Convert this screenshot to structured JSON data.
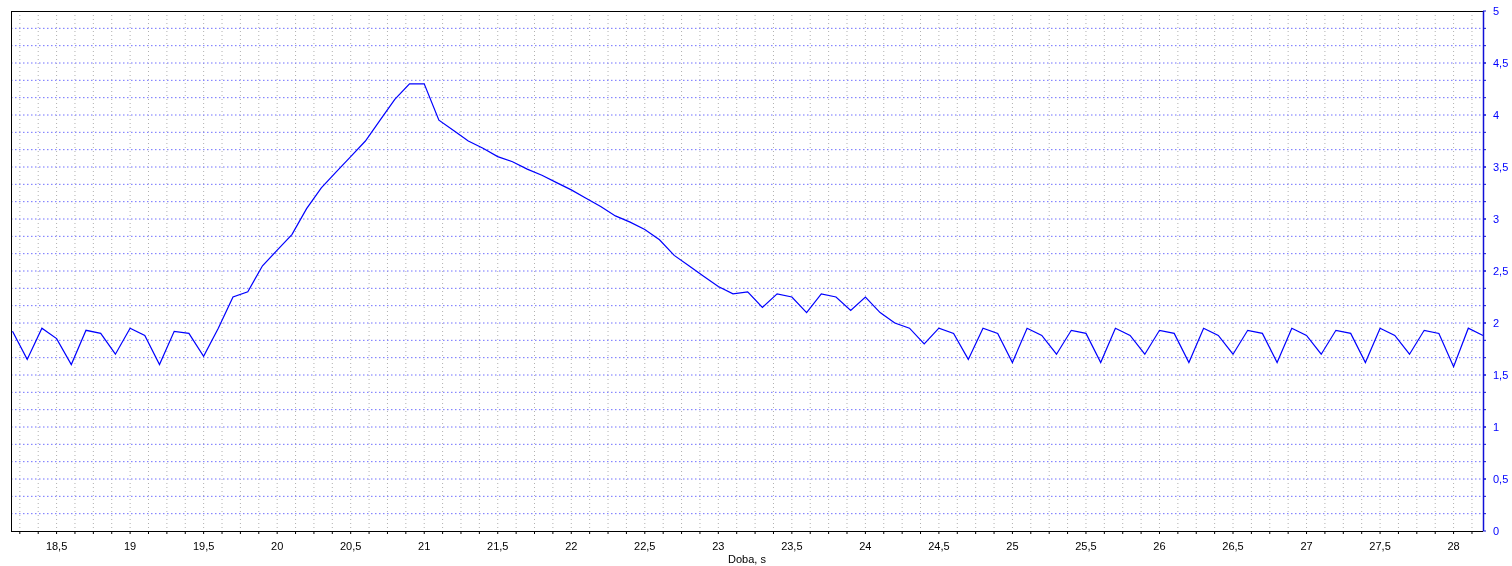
{
  "chart": {
    "chart_data": {
      "type": "line",
      "xlabel": "Doba, s",
      "grid": true,
      "xlim": [
        18.19,
        28.2
      ],
      "ylim": [
        0,
        5
      ],
      "xticks": [
        {
          "value": 18.5,
          "label": "18,5"
        },
        {
          "value": 19,
          "label": "19"
        },
        {
          "value": 19.5,
          "label": "19,5"
        },
        {
          "value": 20,
          "label": "20"
        },
        {
          "value": 20.5,
          "label": "20,5"
        },
        {
          "value": 21,
          "label": "21"
        },
        {
          "value": 21.5,
          "label": "21,5"
        },
        {
          "value": 22,
          "label": "22"
        },
        {
          "value": 22.5,
          "label": "22,5"
        },
        {
          "value": 23,
          "label": "23"
        },
        {
          "value": 23.5,
          "label": "23,5"
        },
        {
          "value": 24,
          "label": "24"
        },
        {
          "value": 24.5,
          "label": "24,5"
        },
        {
          "value": 25,
          "label": "25"
        },
        {
          "value": 25.5,
          "label": "25,5"
        },
        {
          "value": 26,
          "label": "26"
        },
        {
          "value": 26.5,
          "label": "26,5"
        },
        {
          "value": 27,
          "label": "27"
        },
        {
          "value": 27.5,
          "label": "27,5"
        },
        {
          "value": 28,
          "label": "28"
        }
      ],
      "yticks": [
        {
          "value": 0,
          "label": "0"
        },
        {
          "value": 0.5,
          "label": "0,5"
        },
        {
          "value": 1,
          "label": "1"
        },
        {
          "value": 1.5,
          "label": "1,5"
        },
        {
          "value": 2,
          "label": "2"
        },
        {
          "value": 2.5,
          "label": "2,5"
        },
        {
          "value": 3,
          "label": "3"
        },
        {
          "value": 3.5,
          "label": "3,5"
        },
        {
          "value": 4,
          "label": "4"
        },
        {
          "value": 4.5,
          "label": "4,5"
        },
        {
          "value": 5,
          "label": "5"
        }
      ],
      "x": [
        18.2,
        18.3,
        18.4,
        18.5,
        18.6,
        18.7,
        18.8,
        18.9,
        19.0,
        19.1,
        19.2,
        19.3,
        19.4,
        19.5,
        19.6,
        19.7,
        19.8,
        19.9,
        20.0,
        20.1,
        20.2,
        20.3,
        20.4,
        20.5,
        20.6,
        20.7,
        20.8,
        20.9,
        21.0,
        21.1,
        21.2,
        21.3,
        21.4,
        21.5,
        21.6,
        21.7,
        21.8,
        21.9,
        22.0,
        22.1,
        22.2,
        22.3,
        22.4,
        22.5,
        22.6,
        22.7,
        22.8,
        22.9,
        23.0,
        23.1,
        23.2,
        23.3,
        23.4,
        23.5,
        23.6,
        23.7,
        23.8,
        23.9,
        24.0,
        24.1,
        24.2,
        24.3,
        24.4,
        24.5,
        24.6,
        24.7,
        24.8,
        24.9,
        25.0,
        25.1,
        25.2,
        25.3,
        25.4,
        25.5,
        25.6,
        25.7,
        25.8,
        25.9,
        26.0,
        26.1,
        26.2,
        26.3,
        26.4,
        26.5,
        26.6,
        26.7,
        26.8,
        26.9,
        27.0,
        27.1,
        27.2,
        27.3,
        27.4,
        27.5,
        27.6,
        27.7,
        27.8,
        27.9,
        28.0,
        28.1,
        28.2
      ],
      "series": [
        {
          "color": "#0000ff",
          "values": [
            1.92,
            1.65,
            1.95,
            1.85,
            1.6,
            1.93,
            1.9,
            1.7,
            1.95,
            1.88,
            1.6,
            1.92,
            1.9,
            1.68,
            1.95,
            2.25,
            2.3,
            2.55,
            2.7,
            2.85,
            3.1,
            3.3,
            3.45,
            3.6,
            3.75,
            3.95,
            4.15,
            4.3,
            4.3,
            3.95,
            3.85,
            3.75,
            3.68,
            3.6,
            3.55,
            3.48,
            3.42,
            3.35,
            3.28,
            3.2,
            3.12,
            3.03,
            2.97,
            2.9,
            2.8,
            2.65,
            2.55,
            2.45,
            2.35,
            2.28,
            2.3,
            2.15,
            2.28,
            2.25,
            2.1,
            2.28,
            2.25,
            2.12,
            2.25,
            2.1,
            2.0,
            1.95,
            1.8,
            1.95,
            1.9,
            1.65,
            1.95,
            1.9,
            1.62,
            1.95,
            1.88,
            1.7,
            1.93,
            1.9,
            1.62,
            1.95,
            1.88,
            1.7,
            1.93,
            1.9,
            1.62,
            1.95,
            1.88,
            1.7,
            1.93,
            1.9,
            1.62,
            1.95,
            1.88,
            1.7,
            1.93,
            1.9,
            1.62,
            1.95,
            1.88,
            1.7,
            1.93,
            1.9,
            1.58,
            1.95,
            1.88
          ]
        }
      ]
    }
  }
}
